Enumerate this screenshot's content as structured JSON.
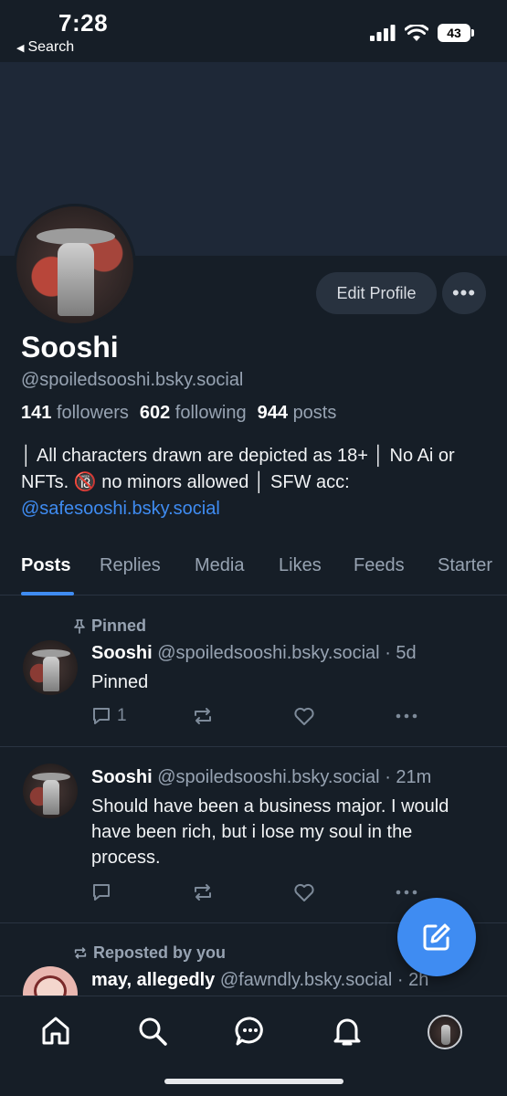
{
  "status_bar": {
    "time": "7:28",
    "back_label": "Search",
    "battery": "43"
  },
  "profile": {
    "edit_label": "Edit Profile",
    "more_label": "•••",
    "name": "Sooshi",
    "handle": "@spoiledsooshi.bsky.social",
    "followers_count": "141",
    "followers_label": "followers",
    "following_count": "602",
    "following_label": "following",
    "posts_count": "944",
    "posts_label": "posts",
    "bio_text": "│ All characters drawn are depicted as 18+ │ No Ai or NFTs. 🔞 no minors allowed │ SFW acc:",
    "bio_link": "@safesooshi.bsky.social"
  },
  "tabs": [
    {
      "label": "Posts",
      "active": true
    },
    {
      "label": "Replies"
    },
    {
      "label": "Media"
    },
    {
      "label": "Likes"
    },
    {
      "label": "Feeds"
    },
    {
      "label": "Starter"
    }
  ],
  "posts": [
    {
      "context_label": "Pinned",
      "author": "Sooshi",
      "handle": "@spoiledsooshi.bsky.social",
      "time": "· 5d",
      "text": "Pinned",
      "reply_count": "1"
    },
    {
      "author": "Sooshi",
      "handle": "@spoiledsooshi.bsky.social",
      "time": "· 21m",
      "text": "Should have been a business major. I would have been rich, but i lose my soul in the process.",
      "reply_count": ""
    },
    {
      "context_label": "Reposted by you",
      "author": "may, allegedly",
      "handle": "@fawndly.bsky.social",
      "time": "· 2h"
    }
  ],
  "colors": {
    "background": "#161e27",
    "accent": "#3f8cf2",
    "muted": "#97a3b2"
  },
  "icons": {
    "nav": [
      "home-icon",
      "search-icon",
      "chat-icon",
      "bell-icon",
      "profile-avatar"
    ],
    "fab": "compose-icon"
  }
}
